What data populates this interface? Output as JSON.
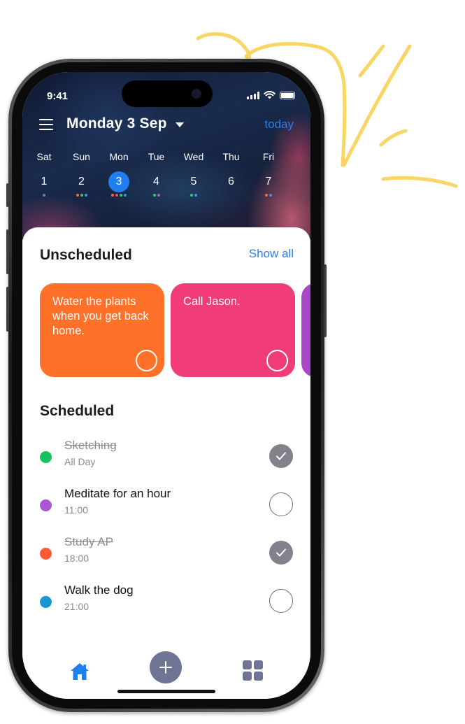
{
  "status_bar": {
    "time": "9:41"
  },
  "header": {
    "title": "Monday 3 Sep",
    "today_label": "today"
  },
  "week": [
    {
      "name": "Sat",
      "num": "1",
      "selected": false,
      "dots": [
        "#a35ad0"
      ]
    },
    {
      "name": "Sun",
      "num": "2",
      "selected": false,
      "dots": [
        "#ff6b2b",
        "#2ecc71",
        "#2b9ee0"
      ]
    },
    {
      "name": "Mon",
      "num": "3",
      "selected": true,
      "dots": [
        "#ff6b2b",
        "#e94b6a",
        "#2ecc71",
        "#2b9ee0"
      ]
    },
    {
      "name": "Tue",
      "num": "4",
      "selected": false,
      "dots": [
        "#2ecc71",
        "#a35ad0"
      ]
    },
    {
      "name": "Wed",
      "num": "5",
      "selected": false,
      "dots": [
        "#2ecc71",
        "#2b9ee0"
      ]
    },
    {
      "name": "Thu",
      "num": "6",
      "selected": false,
      "dots": []
    },
    {
      "name": "Fri",
      "num": "7",
      "selected": false,
      "dots": [
        "#ff6b2b",
        "#2b9ee0"
      ]
    }
  ],
  "unscheduled": {
    "title": "Unscheduled",
    "show_all": "Show all",
    "cards": [
      {
        "text": "Water the plants when you get back home.",
        "color": "#ff7129"
      },
      {
        "text": "Call Jason.",
        "color": "#f03c78"
      },
      {
        "text": "",
        "color": "#a648c8"
      }
    ]
  },
  "scheduled": {
    "title": "Scheduled",
    "tasks": [
      {
        "name": "Sketching",
        "time": "All Day",
        "color": "#16c25a",
        "done": true
      },
      {
        "name": "Meditate for an hour",
        "time": "11:00",
        "color": "#a858d0",
        "done": false
      },
      {
        "name": "Study AP",
        "time": "18:00",
        "color": "#ff5a32",
        "done": true
      },
      {
        "name": "Walk the dog",
        "time": "21:00",
        "color": "#1a96d2",
        "done": false
      }
    ]
  },
  "tabbar": {
    "active": "home-icon",
    "icons": [
      "home-icon",
      "add-icon",
      "grid-icon"
    ]
  },
  "colors": {
    "accent": "#2b7de9",
    "selected_day": "#1f7ff0",
    "check_done": "#82828d",
    "tab_icon": "#6e7493",
    "doodle": "#f9d563"
  }
}
